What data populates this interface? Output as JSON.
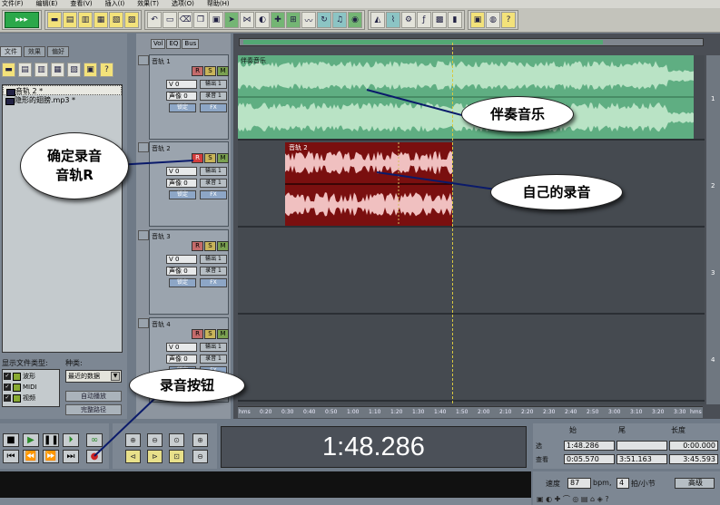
{
  "menu": [
    "文件(F)",
    "编辑(E)",
    "查看(V)",
    "插入(I)",
    "效果(T)",
    "选项(O)",
    "帮助(H)"
  ],
  "toolbar": {
    "mode_label": "▸▸▸",
    "icons": [
      "open-icon",
      "save-icon",
      "save-as-icon",
      "export-icon",
      "mixdown-icon",
      "close-icon",
      "undo-icon",
      "insert-icon",
      "delete-icon",
      "copy-icon",
      "paste-icon",
      "split-icon",
      "time-select-icon",
      "hybrid-icon",
      "move-icon",
      "snap-icon",
      "wave-icon",
      "loop-icon",
      "midi-icon",
      "cd-icon",
      "view-icon",
      "settings-icon",
      "envelope-icon",
      "cpu-icon",
      "help-icon"
    ]
  },
  "left_panel": {
    "tabs": [
      "文件",
      "效果",
      "偏好"
    ],
    "files": [
      "音轨 2 *",
      "隐形的翅膀.mp3 *"
    ],
    "show_types_label": "显示文件类型:",
    "kind_label": "种类:",
    "types": [
      "波形",
      "MIDI",
      "视频"
    ],
    "kind_value": "最近的数据",
    "auto_play": "自动播放",
    "full_paths": "完整路径"
  },
  "track_tabs": [
    "Vol",
    "EQ",
    "Bus"
  ],
  "tracks": [
    {
      "name": "音轨 1",
      "volume": "V 0",
      "record": "R",
      "solo": "S",
      "mute": "M",
      "out": "输出 1",
      "pan": "声像 0",
      "in": "录音 1",
      "lock": "锁定",
      "fx": "FX"
    },
    {
      "name": "音轨 2",
      "volume": "V 0",
      "record": "R",
      "solo": "S",
      "mute": "M",
      "out": "输出 1",
      "pan": "声像 0",
      "in": "录音 1",
      "lock": "锁定",
      "fx": "FX"
    },
    {
      "name": "音轨 3",
      "volume": "V 0",
      "record": "R",
      "solo": "S",
      "mute": "M",
      "out": "输出 1",
      "pan": "声像 0",
      "in": "录音 1",
      "lock": "锁定",
      "fx": "FX"
    },
    {
      "name": "音轨 4",
      "volume": "V 0",
      "record": "R",
      "solo": "S",
      "mute": "M",
      "out": "输出 1",
      "pan": "声像 0",
      "in": "录音 1",
      "lock": "锁定",
      "fx": "FX"
    }
  ],
  "clips": {
    "track1": "伴奏音乐",
    "track2": "音轨 2"
  },
  "track_numbers": [
    "1",
    "2",
    "3",
    "4"
  ],
  "ruler_labels": [
    "hms",
    "0:20",
    "0:30",
    "0:40",
    "0:50",
    "1:00",
    "1:10",
    "1:20",
    "1:30",
    "1:40",
    "1:50",
    "2:00",
    "2:10",
    "2:20",
    "2:30",
    "2:40",
    "2:50",
    "3:00",
    "3:10",
    "3:20",
    "3:30",
    "hms"
  ],
  "time_display": "1:48.286",
  "selection": {
    "headers": [
      "始",
      "尾",
      "长度"
    ],
    "rows": [
      {
        "label": "选",
        "start": "1:48.286",
        "end": "",
        "length": "0:00.000"
      },
      {
        "label": "查看",
        "start": "0:05.570",
        "end": "3:51.163",
        "length": "3:45.593"
      }
    ]
  },
  "tempo": {
    "label": "速度",
    "value": "87",
    "unit": "bpm,",
    "beats": "4",
    "beats_unit": "拍/小节",
    "advanced": "高级"
  },
  "annotations": {
    "accompaniment": "伴奏音乐",
    "my_recording": "自己的录音",
    "confirm_track_line1": "确定录音",
    "confirm_track_line2": "音轨R",
    "record_button": "录音按钮"
  },
  "colors": {
    "track1_wave": "#5fae82",
    "track2_clip": "#7a0f0f",
    "record": "#cc2222",
    "solo": "#7aa050"
  }
}
